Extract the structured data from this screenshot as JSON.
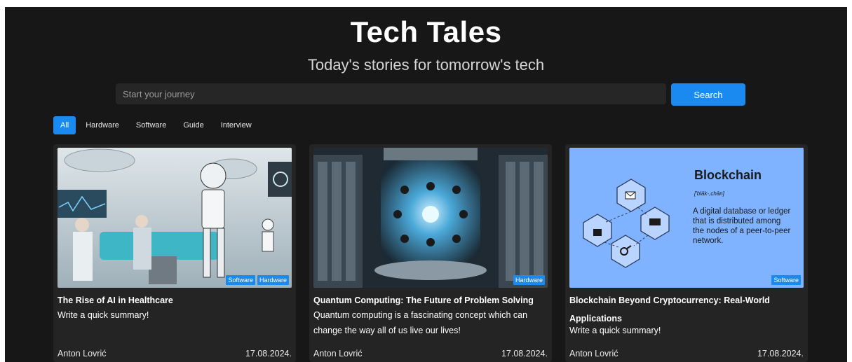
{
  "header": {
    "title": "Tech Tales",
    "subtitle": "Today's stories for tomorrow's tech"
  },
  "search": {
    "placeholder": "Start your journey",
    "button_label": "Search"
  },
  "filters": {
    "items": [
      {
        "label": "All",
        "active": true
      },
      {
        "label": "Hardware",
        "active": false
      },
      {
        "label": "Software",
        "active": false
      },
      {
        "label": "Guide",
        "active": false
      },
      {
        "label": "Interview",
        "active": false
      }
    ]
  },
  "posts": [
    {
      "title": "The Rise of AI in Healthcare",
      "summary": "Write a quick summary!",
      "author": "Anton Lovrić",
      "date": "17.08.2024.",
      "tags": [
        "Software",
        "Hardware"
      ]
    },
    {
      "title": "Quantum Computing: The Future of Problem Solving",
      "summary": "Quantum computing is a fascinating concept which can change the way all of us live our lives!",
      "author": "Anton Lovrić",
      "date": "17.08.2024.",
      "tags": [
        "Hardware"
      ]
    },
    {
      "title": "Blockchain Beyond Cryptocurrency: Real-World Applications",
      "summary": "Write a quick summary!",
      "author": "Anton Lovrić",
      "date": "17.08.2024.",
      "tags": [
        "Software"
      ],
      "image_text": {
        "heading": "Blockchain",
        "pronunciation": "['bläk-,chān]",
        "definition": "A digital database or ledger that is distributed among the nodes of a peer-to-peer network."
      }
    }
  ],
  "colors": {
    "background": "#171717",
    "card": "#242424",
    "accent": "#1a8af0",
    "input": "#262626"
  }
}
